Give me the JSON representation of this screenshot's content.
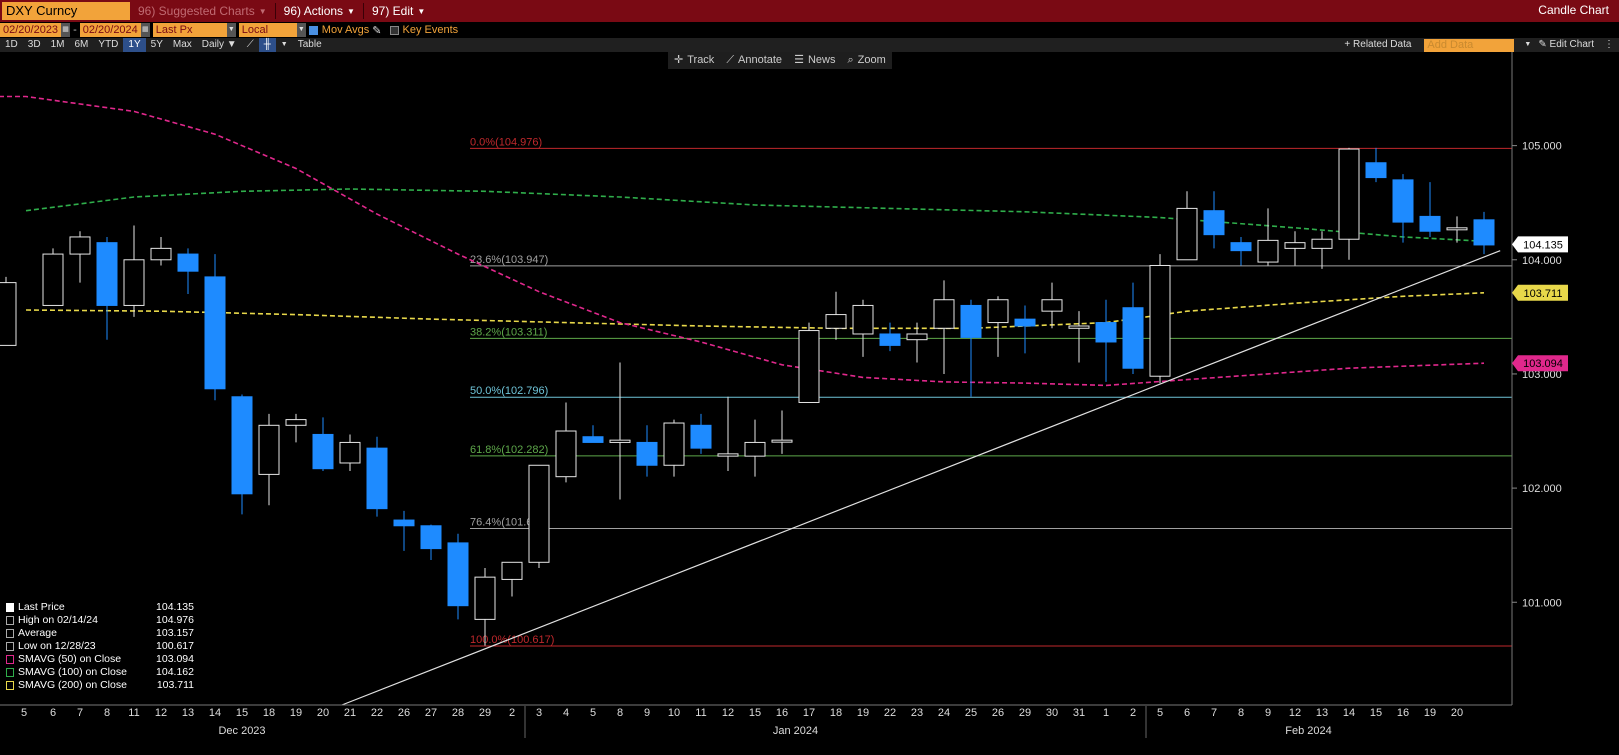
{
  "toolbar": {
    "ticker": "DXY Curncy",
    "suggested": "96) Suggested Charts",
    "actions": "96) Actions",
    "edit": "97) Edit",
    "chart_title": "Candle Chart"
  },
  "bar2": {
    "start_date": "02/20/2023",
    "end_date": "02/20/2024",
    "field": "Last Px",
    "currency": "Local CCY",
    "mov_avgs": "Mov Avgs",
    "key_events": "Key Events"
  },
  "bar3": {
    "periods": [
      "1D",
      "3D",
      "1M",
      "6M",
      "YTD",
      "1Y",
      "5Y",
      "Max"
    ],
    "selected_period": "1Y",
    "frequency": "Daily",
    "table": "Table",
    "related_data": "+ Related Data",
    "add_data": "Add Data",
    "edit_chart": "Edit Chart"
  },
  "tools": [
    "Track",
    "Annotate",
    "News",
    "Zoom"
  ],
  "colors": {
    "up_candle": "#ffffff",
    "down_candle": "#1e8bff",
    "sma50": "#e0288c",
    "sma100": "#2fae4b",
    "sma200": "#e8d84a",
    "fib0": "#c0282c",
    "fib236": "#a0a0a0",
    "fib382": "#5ea84a",
    "fib50": "#6fc4d8",
    "fib618": "#5ea84a",
    "fib764": "#a0a0a0",
    "fib100": "#c0282c",
    "trendline": "#e0e0e0"
  },
  "legend": [
    {
      "label": "Last Price",
      "value": "104.135",
      "color": "#ffffff"
    },
    {
      "label": "High on 02/14/24",
      "value": "104.976",
      "color": "#aaaaaa"
    },
    {
      "label": "Average",
      "value": "103.157",
      "color": "#aaaaaa"
    },
    {
      "label": "Low on 12/28/23",
      "value": "100.617",
      "color": "#aaaaaa"
    },
    {
      "label": "SMAVG (50)  on Close",
      "value": "103.094",
      "color": "#e0288c"
    },
    {
      "label": "SMAVG (100)  on Close",
      "value": "104.162",
      "color": "#2fae4b"
    },
    {
      "label": "SMAVG (200)  on Close",
      "value": "103.711",
      "color": "#e8d84a"
    }
  ],
  "chart_data": {
    "type": "candlestick",
    "ylim": [
      100.1,
      105.75
    ],
    "y_ticks": [
      101.0,
      102.0,
      103.0,
      104.0,
      105.0
    ],
    "y_tick_labels": [
      "101.000",
      "102.000",
      "103.000",
      "104.000",
      "105.000"
    ],
    "x_labels": [
      "5",
      "6",
      "7",
      "8",
      "11",
      "12",
      "13",
      "14",
      "15",
      "18",
      "19",
      "20",
      "21",
      "22",
      "26",
      "27",
      "28",
      "29",
      "2",
      "3",
      "4",
      "5",
      "8",
      "9",
      "10",
      "11",
      "12",
      "15",
      "16",
      "17",
      "18",
      "19",
      "22",
      "23",
      "24",
      "25",
      "26",
      "29",
      "30",
      "31",
      "1",
      "2",
      "5",
      "6",
      "7",
      "8",
      "9",
      "12",
      "13",
      "14",
      "15",
      "16",
      "19",
      "20"
    ],
    "month_labels": [
      {
        "label": "Dec 2023",
        "index": 8.0
      },
      {
        "label": "Jan 2024",
        "index": 28.5
      },
      {
        "label": "Feb 2024",
        "index": 47.5
      }
    ],
    "candles": [
      {
        "o": 103.25,
        "h": 103.85,
        "l": 103.25,
        "c": 103.8
      },
      {
        "o": 103.6,
        "h": 104.1,
        "l": 103.6,
        "c": 104.05
      },
      {
        "o": 104.05,
        "h": 104.25,
        "l": 103.8,
        "c": 104.2
      },
      {
        "o": 104.15,
        "h": 104.2,
        "l": 103.3,
        "c": 103.6
      },
      {
        "o": 103.6,
        "h": 104.3,
        "l": 103.5,
        "c": 104.0
      },
      {
        "o": 104.0,
        "h": 104.2,
        "l": 103.95,
        "c": 104.1
      },
      {
        "o": 104.05,
        "h": 104.1,
        "l": 103.7,
        "c": 103.9
      },
      {
        "o": 103.85,
        "h": 104.05,
        "l": 102.77,
        "c": 102.87
      },
      {
        "o": 102.8,
        "h": 102.82,
        "l": 101.77,
        "c": 101.95
      },
      {
        "o": 102.12,
        "h": 102.65,
        "l": 101.85,
        "c": 102.55
      },
      {
        "o": 102.55,
        "h": 102.65,
        "l": 102.4,
        "c": 102.6
      },
      {
        "o": 102.47,
        "h": 102.62,
        "l": 102.15,
        "c": 102.17
      },
      {
        "o": 102.22,
        "h": 102.47,
        "l": 102.15,
        "c": 102.4
      },
      {
        "o": 102.35,
        "h": 102.45,
        "l": 101.75,
        "c": 101.82
      },
      {
        "o": 101.72,
        "h": 101.8,
        "l": 101.45,
        "c": 101.67
      },
      {
        "o": 101.67,
        "h": 101.68,
        "l": 101.37,
        "c": 101.47
      },
      {
        "o": 101.52,
        "h": 101.6,
        "l": 100.85,
        "c": 100.97
      },
      {
        "o": 100.85,
        "h": 101.3,
        "l": 100.62,
        "c": 101.22
      },
      {
        "o": 101.2,
        "h": 101.35,
        "l": 101.05,
        "c": 101.35
      },
      {
        "o": 101.35,
        "h": 102.2,
        "l": 101.3,
        "c": 102.2
      },
      {
        "o": 102.1,
        "h": 102.75,
        "l": 102.05,
        "c": 102.5
      },
      {
        "o": 102.45,
        "h": 102.55,
        "l": 102.4,
        "c": 102.4
      },
      {
        "o": 102.4,
        "h": 103.1,
        "l": 101.9,
        "c": 102.42
      },
      {
        "o": 102.4,
        "h": 102.55,
        "l": 102.1,
        "c": 102.2
      },
      {
        "o": 102.2,
        "h": 102.6,
        "l": 102.1,
        "c": 102.57
      },
      {
        "o": 102.55,
        "h": 102.65,
        "l": 102.3,
        "c": 102.35
      },
      {
        "o": 102.28,
        "h": 102.8,
        "l": 102.15,
        "c": 102.3
      },
      {
        "o": 102.28,
        "h": 102.6,
        "l": 102.1,
        "c": 102.4
      },
      {
        "o": 102.42,
        "h": 102.68,
        "l": 102.3,
        "c": 102.42
      },
      {
        "o": 102.75,
        "h": 103.45,
        "l": 102.75,
        "c": 103.38
      },
      {
        "o": 103.4,
        "h": 103.72,
        "l": 103.3,
        "c": 103.52
      },
      {
        "o": 103.35,
        "h": 103.65,
        "l": 103.15,
        "c": 103.6
      },
      {
        "o": 103.35,
        "h": 103.45,
        "l": 103.2,
        "c": 103.25
      },
      {
        "o": 103.3,
        "h": 103.45,
        "l": 103.1,
        "c": 103.35
      },
      {
        "o": 103.4,
        "h": 103.82,
        "l": 103.0,
        "c": 103.65
      },
      {
        "o": 103.6,
        "h": 103.65,
        "l": 102.8,
        "c": 103.32
      },
      {
        "o": 103.45,
        "h": 103.68,
        "l": 103.15,
        "c": 103.65
      },
      {
        "o": 103.48,
        "h": 103.6,
        "l": 103.18,
        "c": 103.42
      },
      {
        "o": 103.55,
        "h": 103.8,
        "l": 103.4,
        "c": 103.65
      },
      {
        "o": 103.4,
        "h": 103.55,
        "l": 103.1,
        "c": 103.42
      },
      {
        "o": 103.45,
        "h": 103.65,
        "l": 102.93,
        "c": 103.28
      },
      {
        "o": 103.58,
        "h": 103.8,
        "l": 103.0,
        "c": 103.05
      },
      {
        "o": 102.98,
        "h": 104.05,
        "l": 102.92,
        "c": 103.95
      },
      {
        "o": 104.0,
        "h": 104.6,
        "l": 104.0,
        "c": 104.45
      },
      {
        "o": 104.43,
        "h": 104.6,
        "l": 104.1,
        "c": 104.22
      },
      {
        "o": 104.15,
        "h": 104.2,
        "l": 103.95,
        "c": 104.08
      },
      {
        "o": 103.98,
        "h": 104.45,
        "l": 103.95,
        "c": 104.17
      },
      {
        "o": 104.1,
        "h": 104.25,
        "l": 103.95,
        "c": 104.15
      },
      {
        "o": 104.1,
        "h": 104.25,
        "l": 103.92,
        "c": 104.18
      },
      {
        "o": 104.18,
        "h": 104.98,
        "l": 104.0,
        "c": 104.97
      },
      {
        "o": 104.85,
        "h": 104.98,
        "l": 104.68,
        "c": 104.72
      },
      {
        "o": 104.7,
        "h": 104.75,
        "l": 104.15,
        "c": 104.33
      },
      {
        "o": 104.38,
        "h": 104.68,
        "l": 104.2,
        "c": 104.25
      },
      {
        "o": 104.27,
        "h": 104.38,
        "l": 104.15,
        "c": 104.28
      },
      {
        "o": 104.35,
        "h": 104.42,
        "l": 104.05,
        "c": 104.13
      }
    ],
    "sma50": [
      [
        0,
        105.43
      ],
      [
        4,
        105.3
      ],
      [
        7,
        105.1
      ],
      [
        10,
        104.8
      ],
      [
        13,
        104.4
      ],
      [
        16,
        104.05
      ],
      [
        19,
        103.72
      ],
      [
        22,
        103.45
      ],
      [
        25,
        103.28
      ],
      [
        28,
        103.08
      ],
      [
        31,
        102.97
      ],
      [
        34,
        102.93
      ],
      [
        37,
        102.92
      ],
      [
        40,
        102.9
      ],
      [
        43,
        102.95
      ],
      [
        46,
        103.0
      ],
      [
        49,
        103.05
      ],
      [
        54,
        103.094
      ]
    ],
    "sma100": [
      [
        0,
        104.43
      ],
      [
        4,
        104.55
      ],
      [
        8,
        104.6
      ],
      [
        12,
        104.62
      ],
      [
        17,
        104.6
      ],
      [
        22,
        104.55
      ],
      [
        27,
        104.48
      ],
      [
        32,
        104.45
      ],
      [
        37,
        104.42
      ],
      [
        42,
        104.37
      ],
      [
        47,
        104.28
      ],
      [
        51,
        104.2
      ],
      [
        54,
        104.162
      ]
    ],
    "sma200": [
      [
        0,
        103.56
      ],
      [
        5,
        103.55
      ],
      [
        10,
        103.52
      ],
      [
        15,
        103.48
      ],
      [
        20,
        103.45
      ],
      [
        25,
        103.42
      ],
      [
        30,
        103.4
      ],
      [
        35,
        103.4
      ],
      [
        40,
        103.45
      ],
      [
        43,
        103.55
      ],
      [
        47,
        103.62
      ],
      [
        51,
        103.68
      ],
      [
        54,
        103.711
      ]
    ],
    "trendline": {
      "start": [
        11.7,
        100.1
      ],
      "end": [
        54.6,
        104.08
      ]
    },
    "fib_levels": [
      {
        "label": "0.0%(104.976)",
        "value": 104.976,
        "color_key": "fib0"
      },
      {
        "label": "23.6%(103.947)",
        "value": 103.947,
        "color_key": "fib236"
      },
      {
        "label": "38.2%(103.311)",
        "value": 103.311,
        "color_key": "fib382"
      },
      {
        "label": "50.0%(102.796)",
        "value": 102.796,
        "color_key": "fib50"
      },
      {
        "label": "61.8%(102.282)",
        "value": 102.282,
        "color_key": "fib618"
      },
      {
        "label": "76.4%(101.646)",
        "value": 101.646,
        "color_key": "fib764"
      },
      {
        "label": "100.0%(100.617)",
        "value": 100.617,
        "color_key": "fib100"
      }
    ],
    "price_tags": [
      {
        "value": 104.135,
        "text": "104.135",
        "bg": "#ffffff",
        "fg": "#000000"
      },
      {
        "value": 103.711,
        "text": "103.711",
        "bg": "#e8d84a",
        "fg": "#000000"
      },
      {
        "value": 103.094,
        "text": "103.094",
        "bg": "#e0288c",
        "fg": "#000000"
      }
    ]
  }
}
